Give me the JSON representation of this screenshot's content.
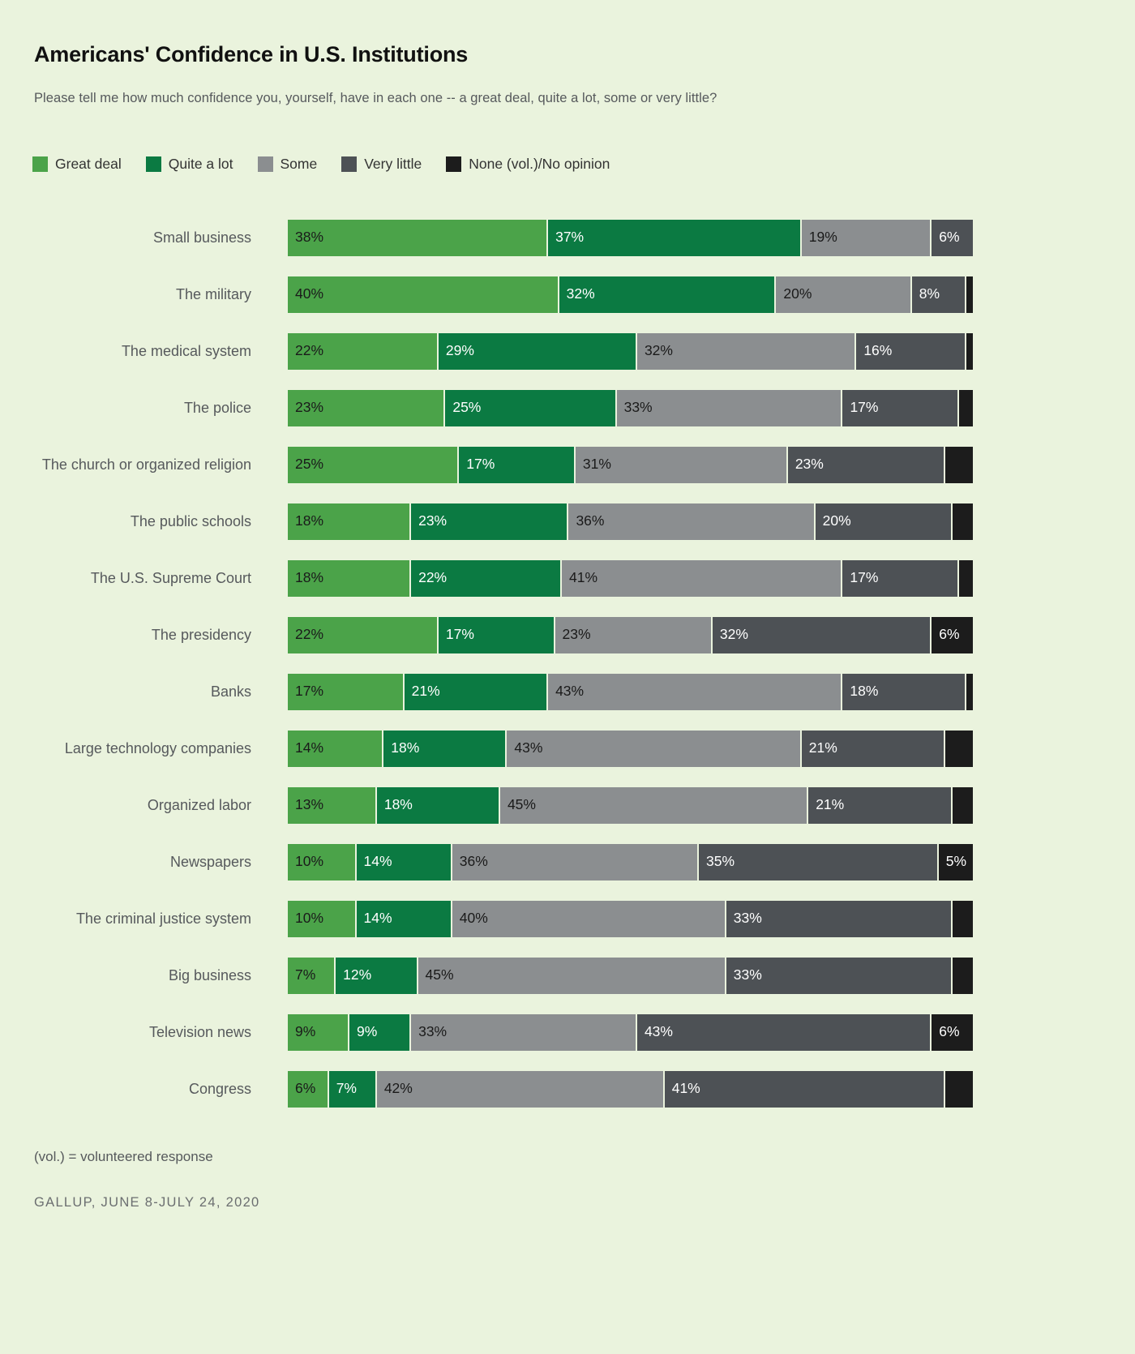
{
  "header": {
    "title": "Americans' Confidence in U.S. Institutions",
    "subtitle": "Please tell me how much confidence you, yourself, have in each one -- a great deal, quite a lot, some or very little?"
  },
  "footer": {
    "footnote": "(vol.) = volunteered response",
    "source": "GALLUP, JUNE 8-JULY 24, 2020"
  },
  "colors": {
    "background": "#eaf3dd",
    "great_deal": "#4ba349",
    "quite_a_lot": "#0b7a42",
    "some": "#8b8e90",
    "very_little": "#4d5155",
    "none": "#1c1c1c",
    "title_text": "#111111",
    "body_text": "#56595c"
  },
  "legend": [
    {
      "label": "Great deal",
      "color": "#4ba349",
      "key": "great_deal"
    },
    {
      "label": "Quite a lot",
      "color": "#0b7a42",
      "key": "quite_a_lot"
    },
    {
      "label": "Some",
      "color": "#8b8e90",
      "key": "some"
    },
    {
      "label": "Very little",
      "color": "#4d5155",
      "key": "very_little"
    },
    {
      "label": "None (vol.)/No opinion",
      "color": "#1c1c1c",
      "key": "none"
    }
  ],
  "chart_data": {
    "type": "bar",
    "orientation": "horizontal",
    "stacked": true,
    "stack_total": 100,
    "title": "Americans' Confidence in U.S. Institutions",
    "subtitle": "Please tell me how much confidence you, yourself, have in each one -- a great deal, quite a lot, some or very little?",
    "xlabel": "",
    "ylabel": "",
    "xlim": [
      0,
      100
    ],
    "grid": false,
    "legend_position": "top-left",
    "value_suffix": "%",
    "series": [
      {
        "name": "Great deal",
        "color": "#4ba349",
        "values": [
          38,
          40,
          22,
          23,
          25,
          18,
          18,
          22,
          17,
          14,
          13,
          10,
          10,
          7,
          9,
          6
        ]
      },
      {
        "name": "Quite a lot",
        "color": "#0b7a42",
        "values": [
          37,
          32,
          29,
          25,
          17,
          23,
          22,
          17,
          21,
          18,
          18,
          14,
          14,
          12,
          9,
          7
        ]
      },
      {
        "name": "Some",
        "color": "#8b8e90",
        "values": [
          19,
          20,
          32,
          33,
          31,
          36,
          41,
          23,
          43,
          43,
          45,
          36,
          40,
          45,
          33,
          42
        ]
      },
      {
        "name": "Very little",
        "color": "#4d5155",
        "values": [
          6,
          8,
          16,
          17,
          23,
          20,
          17,
          32,
          18,
          21,
          21,
          35,
          33,
          33,
          43,
          41
        ]
      },
      {
        "name": "None (vol.)/No opinion",
        "color": "#1c1c1c",
        "values": [
          0,
          1,
          1,
          1,
          3,
          2,
          2,
          6,
          1,
          3,
          2,
          5,
          3,
          2,
          6,
          3
        ]
      }
    ],
    "categories": [
      "Small business",
      "The military",
      "The medical system",
      "The police",
      "The church or organized religion",
      "The public schools",
      "The U.S. Supreme Court",
      "The presidency",
      "Banks",
      "Large technology companies",
      "Organized labor",
      "Newspapers",
      "The criminal justice system",
      "Big business",
      "Television news",
      "Congress"
    ],
    "rows": [
      {
        "label": "Small business",
        "segments": [
          {
            "k": "great",
            "v": 38,
            "t": "38%"
          },
          {
            "k": "quite",
            "v": 37,
            "t": "37%"
          },
          {
            "k": "some",
            "v": 19,
            "t": "19%"
          },
          {
            "k": "very",
            "v": 6,
            "t": "6%"
          },
          {
            "k": "none",
            "v": 0,
            "t": ""
          }
        ]
      },
      {
        "label": "The military",
        "segments": [
          {
            "k": "great",
            "v": 40,
            "t": "40%"
          },
          {
            "k": "quite",
            "v": 32,
            "t": "32%"
          },
          {
            "k": "some",
            "v": 20,
            "t": "20%"
          },
          {
            "k": "very",
            "v": 8,
            "t": "8%"
          },
          {
            "k": "none",
            "v": 1,
            "t": ""
          }
        ]
      },
      {
        "label": "The medical system",
        "segments": [
          {
            "k": "great",
            "v": 22,
            "t": "22%"
          },
          {
            "k": "quite",
            "v": 29,
            "t": "29%"
          },
          {
            "k": "some",
            "v": 32,
            "t": "32%"
          },
          {
            "k": "very",
            "v": 16,
            "t": "16%"
          },
          {
            "k": "none",
            "v": 1,
            "t": ""
          }
        ]
      },
      {
        "label": "The police",
        "segments": [
          {
            "k": "great",
            "v": 23,
            "t": "23%"
          },
          {
            "k": "quite",
            "v": 25,
            "t": "25%"
          },
          {
            "k": "some",
            "v": 33,
            "t": "33%"
          },
          {
            "k": "very",
            "v": 17,
            "t": "17%"
          },
          {
            "k": "none",
            "v": 2,
            "t": ""
          }
        ]
      },
      {
        "label": "The church or organized religion",
        "segments": [
          {
            "k": "great",
            "v": 25,
            "t": "25%"
          },
          {
            "k": "quite",
            "v": 17,
            "t": "17%"
          },
          {
            "k": "some",
            "v": 31,
            "t": "31%"
          },
          {
            "k": "very",
            "v": 23,
            "t": "23%"
          },
          {
            "k": "none",
            "v": 4,
            "t": ""
          }
        ]
      },
      {
        "label": "The public schools",
        "segments": [
          {
            "k": "great",
            "v": 18,
            "t": "18%"
          },
          {
            "k": "quite",
            "v": 23,
            "t": "23%"
          },
          {
            "k": "some",
            "v": 36,
            "t": "36%"
          },
          {
            "k": "very",
            "v": 20,
            "t": "20%"
          },
          {
            "k": "none",
            "v": 3,
            "t": ""
          }
        ]
      },
      {
        "label": "The U.S. Supreme Court",
        "segments": [
          {
            "k": "great",
            "v": 18,
            "t": "18%"
          },
          {
            "k": "quite",
            "v": 22,
            "t": "22%"
          },
          {
            "k": "some",
            "v": 41,
            "t": "41%"
          },
          {
            "k": "very",
            "v": 17,
            "t": "17%"
          },
          {
            "k": "none",
            "v": 2,
            "t": ""
          }
        ]
      },
      {
        "label": "The presidency",
        "segments": [
          {
            "k": "great",
            "v": 22,
            "t": "22%"
          },
          {
            "k": "quite",
            "v": 17,
            "t": "17%"
          },
          {
            "k": "some",
            "v": 23,
            "t": "23%"
          },
          {
            "k": "very",
            "v": 32,
            "t": "32%"
          },
          {
            "k": "none",
            "v": 6,
            "t": "6%"
          }
        ]
      },
      {
        "label": "Banks",
        "segments": [
          {
            "k": "great",
            "v": 17,
            "t": "17%"
          },
          {
            "k": "quite",
            "v": 21,
            "t": "21%"
          },
          {
            "k": "some",
            "v": 43,
            "t": "43%"
          },
          {
            "k": "very",
            "v": 18,
            "t": "18%"
          },
          {
            "k": "none",
            "v": 1,
            "t": ""
          }
        ]
      },
      {
        "label": "Large technology companies",
        "segments": [
          {
            "k": "great",
            "v": 14,
            "t": "14%"
          },
          {
            "k": "quite",
            "v": 18,
            "t": "18%"
          },
          {
            "k": "some",
            "v": 43,
            "t": "43%"
          },
          {
            "k": "very",
            "v": 21,
            "t": "21%"
          },
          {
            "k": "none",
            "v": 4,
            "t": ""
          }
        ]
      },
      {
        "label": "Organized labor",
        "segments": [
          {
            "k": "great",
            "v": 13,
            "t": "13%"
          },
          {
            "k": "quite",
            "v": 18,
            "t": "18%"
          },
          {
            "k": "some",
            "v": 45,
            "t": "45%"
          },
          {
            "k": "very",
            "v": 21,
            "t": "21%"
          },
          {
            "k": "none",
            "v": 3,
            "t": ""
          }
        ]
      },
      {
        "label": "Newspapers",
        "segments": [
          {
            "k": "great",
            "v": 10,
            "t": "10%"
          },
          {
            "k": "quite",
            "v": 14,
            "t": "14%"
          },
          {
            "k": "some",
            "v": 36,
            "t": "36%"
          },
          {
            "k": "very",
            "v": 35,
            "t": "35%"
          },
          {
            "k": "none",
            "v": 5,
            "t": "5%"
          }
        ]
      },
      {
        "label": "The criminal justice system",
        "segments": [
          {
            "k": "great",
            "v": 10,
            "t": "10%"
          },
          {
            "k": "quite",
            "v": 14,
            "t": "14%"
          },
          {
            "k": "some",
            "v": 40,
            "t": "40%"
          },
          {
            "k": "very",
            "v": 33,
            "t": "33%"
          },
          {
            "k": "none",
            "v": 3,
            "t": ""
          }
        ]
      },
      {
        "label": "Big business",
        "segments": [
          {
            "k": "great",
            "v": 7,
            "t": "7%"
          },
          {
            "k": "quite",
            "v": 12,
            "t": "12%"
          },
          {
            "k": "some",
            "v": 45,
            "t": "45%"
          },
          {
            "k": "very",
            "v": 33,
            "t": "33%"
          },
          {
            "k": "none",
            "v": 3,
            "t": ""
          }
        ]
      },
      {
        "label": "Television news",
        "segments": [
          {
            "k": "great",
            "v": 9,
            "t": "9%"
          },
          {
            "k": "quite",
            "v": 9,
            "t": "9%"
          },
          {
            "k": "some",
            "v": 33,
            "t": "33%"
          },
          {
            "k": "very",
            "v": 43,
            "t": "43%"
          },
          {
            "k": "none",
            "v": 6,
            "t": "6%"
          }
        ]
      },
      {
        "label": "Congress",
        "segments": [
          {
            "k": "great",
            "v": 6,
            "t": "6%"
          },
          {
            "k": "quite",
            "v": 7,
            "t": "7%"
          },
          {
            "k": "some",
            "v": 42,
            "t": "42%"
          },
          {
            "k": "very",
            "v": 41,
            "t": "41%"
          },
          {
            "k": "none",
            "v": 4,
            "t": ""
          }
        ]
      }
    ]
  }
}
